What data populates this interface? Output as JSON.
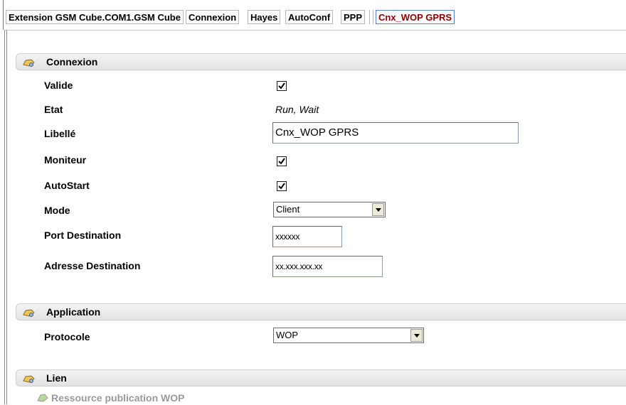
{
  "tabs": [
    {
      "label": "Extension GSM Cube.COM1.GSM Cube",
      "active": false
    },
    {
      "label": "Connexion",
      "active": false
    },
    {
      "label": "Hayes",
      "active": false
    },
    {
      "label": "AutoConf",
      "active": false
    },
    {
      "label": "PPP",
      "active": false
    },
    {
      "label": "Cnx_WOP GPRS",
      "active": true
    }
  ],
  "sections": {
    "connexion": {
      "title": "Connexion",
      "fields": {
        "valide": {
          "label": "Valide",
          "checked": true
        },
        "etat": {
          "label": "Etat",
          "value": "Run, Wait"
        },
        "libelle": {
          "label": "Libellé",
          "value": "Cnx_WOP GPRS"
        },
        "moniteur": {
          "label": "Moniteur",
          "checked": true
        },
        "autostart": {
          "label": "AutoStart",
          "checked": true
        },
        "mode": {
          "label": "Mode",
          "value": "Client"
        },
        "port_destination": {
          "label": "Port Destination",
          "value": "xxxxxx"
        },
        "adresse_destination": {
          "label": "Adresse Destination",
          "value": "xx.xxx.xxx.xx"
        }
      }
    },
    "application": {
      "title": "Application",
      "fields": {
        "protocole": {
          "label": "Protocole",
          "value": "WOP"
        }
      }
    },
    "lien": {
      "title": "Lien",
      "items": [
        {
          "label": "Ressource publication WOP"
        }
      ]
    }
  },
  "colors": {
    "active_tab_text": "#8b0000",
    "section_header_bg": "#e8e8e8",
    "check_mark": "#000000"
  },
  "icons": {
    "section_header": "folder-key-icon",
    "dropdown": "chevron-down-icon",
    "lien_item": "resource-icon"
  }
}
